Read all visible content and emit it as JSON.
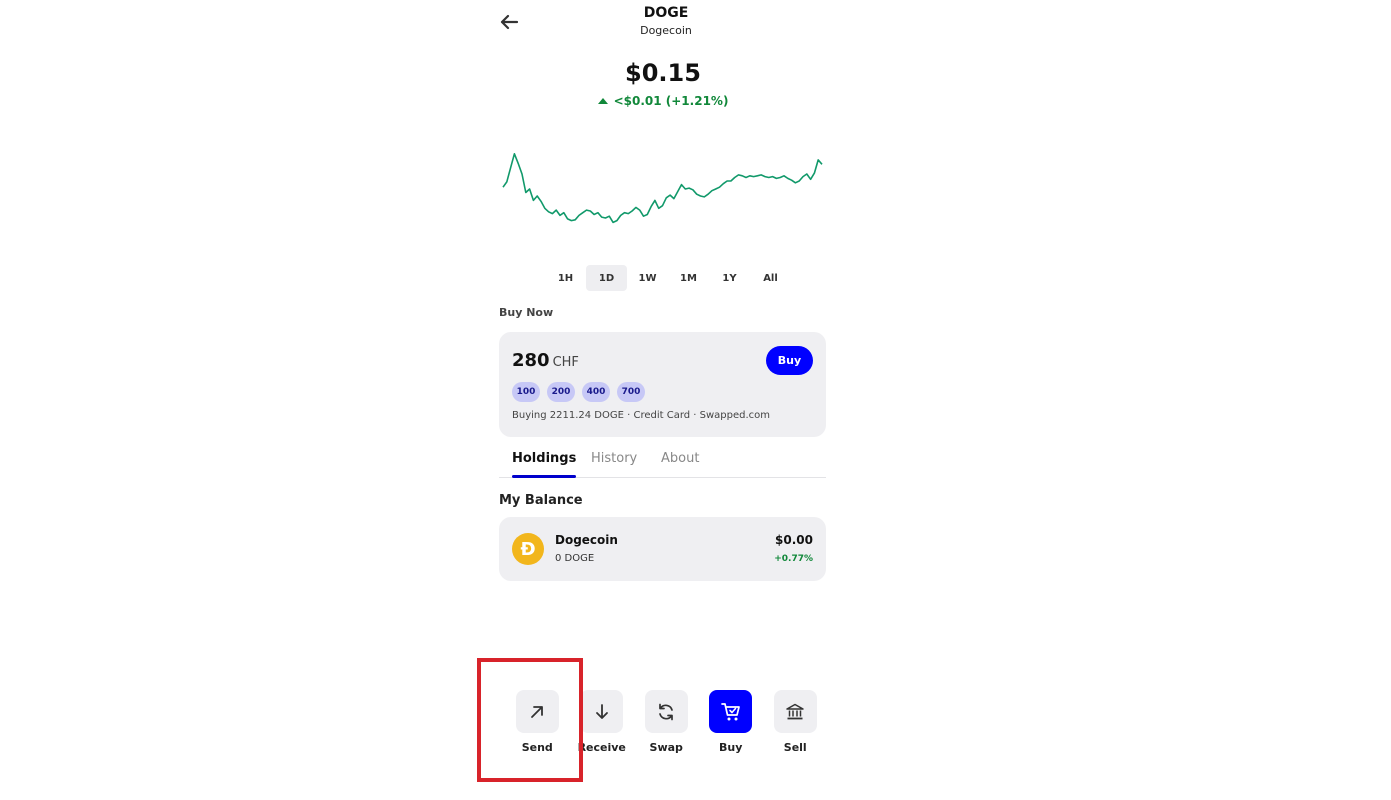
{
  "header": {
    "ticker": "DOGE",
    "name": "Dogecoin"
  },
  "price": {
    "value": "$0.15",
    "change": "<$0.01 (+1.21%)",
    "direction": "up",
    "color": "#11883a"
  },
  "chart_data": {
    "type": "line",
    "title": "",
    "xlabel": "",
    "ylabel": "",
    "grid": false,
    "legend": "none",
    "color": "#11996a",
    "ylim": [
      0,
      100
    ],
    "values": [
      60,
      66,
      82,
      98,
      87,
      75,
      54,
      58,
      45,
      50,
      44,
      36,
      32,
      30,
      34,
      28,
      31,
      24,
      22,
      23,
      28,
      31,
      34,
      33,
      29,
      31,
      26,
      25,
      27,
      20,
      22,
      28,
      31,
      30,
      33,
      37,
      34,
      27,
      29,
      38,
      45,
      36,
      39,
      48,
      51,
      47,
      55,
      63,
      58,
      59,
      57,
      52,
      50,
      49,
      52,
      56,
      58,
      60,
      64,
      67,
      67,
      71,
      74,
      73,
      71,
      73,
      72,
      73,
      74,
      72,
      71,
      72,
      70,
      71,
      73,
      70,
      68,
      65,
      67,
      72,
      75,
      69,
      76,
      91,
      86
    ]
  },
  "ranges": {
    "items": [
      {
        "label": "1H",
        "active": false
      },
      {
        "label": "1D",
        "active": true
      },
      {
        "label": "1W",
        "active": false
      },
      {
        "label": "1M",
        "active": false
      },
      {
        "label": "1Y",
        "active": false
      },
      {
        "label": "All",
        "active": false
      }
    ]
  },
  "buy_now": {
    "section_label": "Buy Now",
    "amount": "280",
    "currency": "CHF",
    "button_label": "Buy",
    "presets": [
      "100",
      "200",
      "400",
      "700"
    ],
    "info": "Buying 2211.24 DOGE · Credit Card · Swapped.com",
    "accent_color": "#0000ff"
  },
  "tabs": [
    {
      "label": "Holdings",
      "active": true
    },
    {
      "label": "History",
      "active": false
    },
    {
      "label": "About",
      "active": false
    }
  ],
  "balance": {
    "title": "My Balance",
    "coin_symbol": "Ð",
    "name": "Dogecoin",
    "amount": "0 DOGE",
    "value": "$0.00",
    "change": "+0.77%"
  },
  "actions": [
    {
      "label": "Send",
      "icon": "arrow-up-right-icon"
    },
    {
      "label": "Receive",
      "icon": "arrow-down-icon"
    },
    {
      "label": "Swap",
      "icon": "swap-icon"
    },
    {
      "label": "Buy",
      "icon": "cart-icon"
    },
    {
      "label": "Sell",
      "icon": "bank-icon"
    }
  ]
}
